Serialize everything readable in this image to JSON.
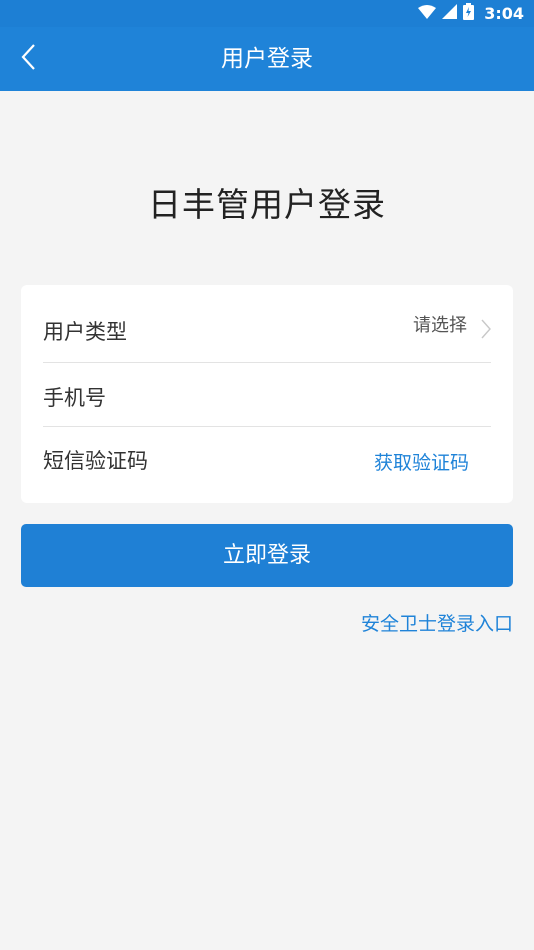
{
  "status_bar": {
    "time": "3:04",
    "icons": [
      "wifi-icon",
      "cell-signal-icon",
      "battery-icon"
    ]
  },
  "nav": {
    "back_icon": "chevron-left-icon",
    "title": "用户登录"
  },
  "heading": "日丰管用户登录",
  "form": {
    "user_type": {
      "label": "用户类型",
      "placeholder": "请选择",
      "icon": "chevron-right-icon"
    },
    "phone": {
      "label": "手机号",
      "value": ""
    },
    "sms_code": {
      "label": "短信验证码",
      "value": "",
      "get_code_label": "获取验证码"
    }
  },
  "login_button": "立即登录",
  "security_link": "安全卫士登录入口",
  "colors": {
    "primary": "#1f83d8",
    "background": "#f4f4f4",
    "card": "#ffffff"
  }
}
